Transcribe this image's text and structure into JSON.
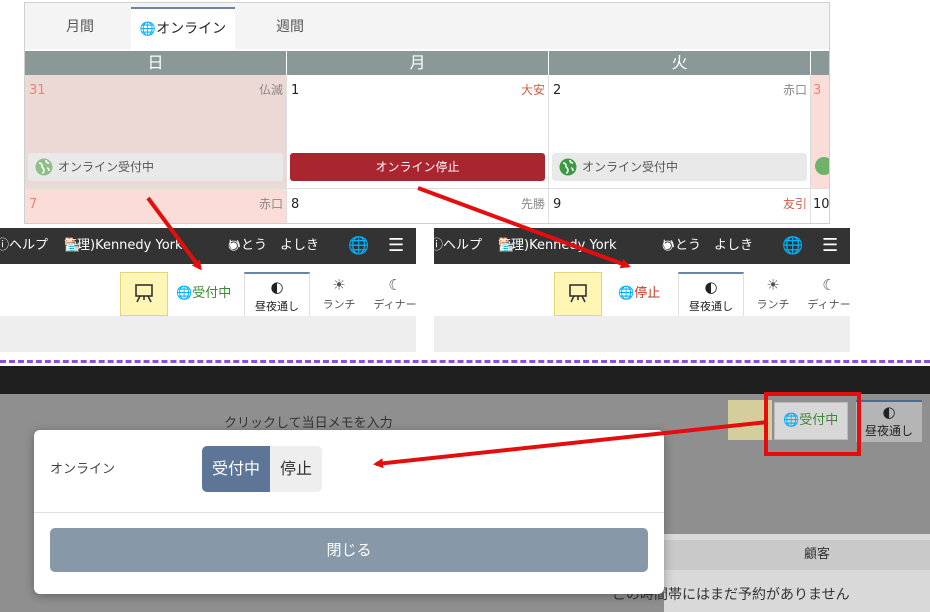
{
  "calendar": {
    "tabs": [
      {
        "label": "月間",
        "active": false
      },
      {
        "label": "オンライン",
        "active": true
      },
      {
        "label": "週間",
        "active": false
      }
    ],
    "weekdays": [
      "日",
      "月",
      "火"
    ],
    "row1": [
      {
        "day": "31",
        "rokuyo": "仏滅",
        "status": "オンライン受付中"
      },
      {
        "day": "1",
        "rokuyo": "大安",
        "status": "オンライン停止"
      },
      {
        "day": "2",
        "rokuyo": "赤口",
        "status": "オンライン受付中"
      },
      {
        "day": "3"
      }
    ],
    "row2": [
      {
        "day": "7",
        "rokuyo": "赤口"
      },
      {
        "day": "8",
        "rokuyo": "先勝"
      },
      {
        "day": "9",
        "rokuyo": "友引"
      },
      {
        "day": "10"
      }
    ]
  },
  "strips": [
    {
      "nav": {
        "help": "ヘルプ",
        "store": "管理)Kennedy York",
        "user": "いとう　よしき"
      },
      "status": "受付中",
      "status_color": "#3b8a35",
      "modes": [
        "昼夜通し",
        "ランチ",
        "ディナー"
      ]
    },
    {
      "nav": {
        "help": "ヘルプ",
        "store": "管理)Kennedy York",
        "user": "いとう　よしき"
      },
      "status": "停止",
      "status_color": "#c0392b",
      "modes": [
        "昼夜通し",
        "ランチ",
        "ディナー"
      ]
    }
  ],
  "bottom": {
    "memo_hint": "クリックして当日メモを入力",
    "status_chip": "受付中",
    "mode": "昼夜通し",
    "column_header": "顧客",
    "empty_message": "この時間帯にはまだ予約がありません"
  },
  "modal": {
    "label": "オンライン",
    "options": [
      "受付中",
      "停止"
    ],
    "selected": "受付中",
    "close_label": "閉じる"
  },
  "colors": {
    "accent": "#5d7596",
    "stop_red": "#a9252f",
    "ok_green": "#3b8a35",
    "annotation_red": "#e50d0d",
    "divider_purple": "#8c4fdc"
  }
}
